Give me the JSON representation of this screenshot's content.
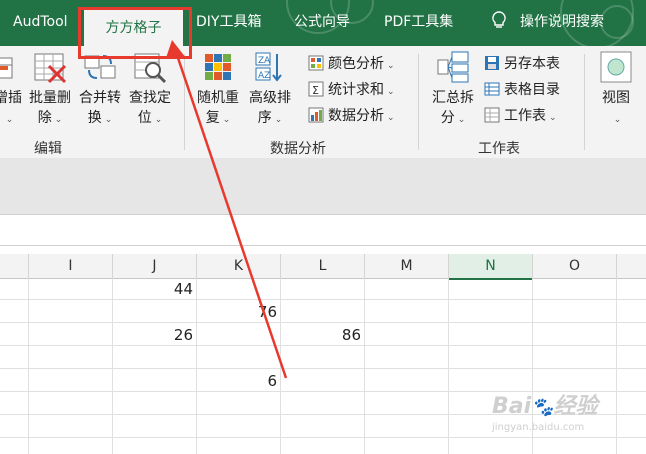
{
  "tabs": {
    "audtool": "AudTool",
    "fangfang": "方方格子",
    "diy": "DIY工具箱",
    "formula": "公式向导",
    "pdf": "PDF工具集",
    "search": "操作说明搜索"
  },
  "ribbon": {
    "edit_group": {
      "partial_insert": "插",
      "partial_insert_prefix": "增",
      "batch_delete_1": "批量删",
      "batch_delete_2": "除",
      "merge_convert_1": "合并转",
      "merge_convert_2": "换",
      "find_locate_1": "查找定",
      "find_locate_2": "位",
      "label": "编辑"
    },
    "data_group": {
      "random_1": "随机重",
      "random_2": "复",
      "sort_1": "高级排",
      "sort_2": "序",
      "color_analysis": "颜色分析",
      "stat_sum": "统计求和",
      "data_analysis": "数据分析",
      "label": "数据分析"
    },
    "sheet_group": {
      "summary_1": "汇总拆",
      "summary_2": "分",
      "save_sheet": "另存本表",
      "table_index": "表格目录",
      "worksheet": "工作表",
      "label": "工作表"
    },
    "view_group": {
      "view": "视图"
    }
  },
  "grid": {
    "columns": [
      "I",
      "J",
      "K",
      "L",
      "M",
      "N",
      "O"
    ],
    "selected_column": "N",
    "cells": {
      "J_r1": "44",
      "K_r2": "76",
      "J_r3": "26",
      "L_r3": "86",
      "K_r5": "6"
    }
  },
  "watermark": {
    "brand": "Bai",
    "brand2": "经验",
    "url": "jingyan.baidu.com"
  },
  "colors": {
    "ribbon_green": "#217346",
    "annotation_red": "#e8392f"
  }
}
